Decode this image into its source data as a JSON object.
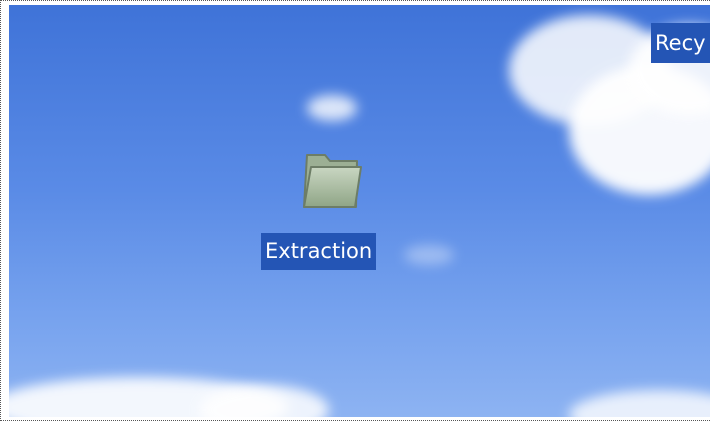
{
  "desktop": {
    "icons": [
      {
        "label": "Extraction",
        "icon": "folder-icon"
      },
      {
        "label": "Recy",
        "icon": "recycle-bin-icon"
      }
    ]
  },
  "colors": {
    "sky_top": "#3f73d8",
    "sky_bottom": "#8db3f2",
    "selection": "#2455b5",
    "label_text": "#ffffff"
  }
}
